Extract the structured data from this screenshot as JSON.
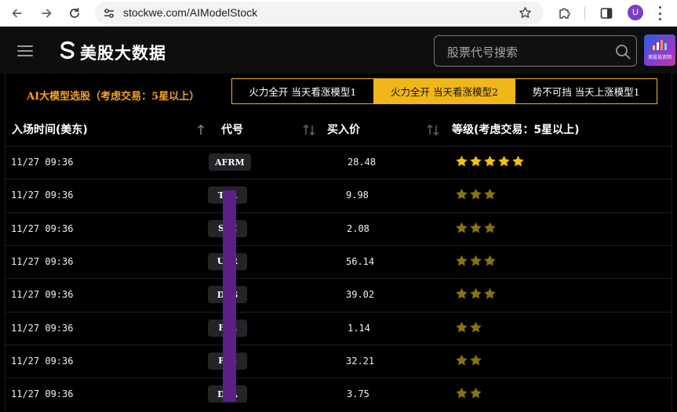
{
  "browser": {
    "url": "stockwe.com/AIModelStock",
    "avatar_letter": "U"
  },
  "header": {
    "logo_text": "美股大数据",
    "search_placeholder": "股票代号搜索",
    "promo_text": "美股投资网"
  },
  "page": {
    "ai_title": "AI大模型选股（考虑交易：5星以上）",
    "tabs": [
      {
        "label": "火力全开 当天看涨模型1",
        "active": false
      },
      {
        "label": "火力全开 当天看涨模型2",
        "active": true
      },
      {
        "label": "势不可挡 当天上涨模型1",
        "active": false
      }
    ],
    "columns": {
      "time": "入场时间(美东)",
      "symbol": "代号",
      "price": "买入价",
      "grade": "等级(考虑交易：5星以上)"
    },
    "rows": [
      {
        "time": "11/27 09:36",
        "symbol": "AFRM",
        "price": "28.48",
        "stars": 5
      },
      {
        "time": "11/27 09:36",
        "symbol": "T  A",
        "price": "9.98",
        "stars": 3
      },
      {
        "time": "11/27 09:36",
        "symbol": "S  E",
        "price": "2.08",
        "stars": 3
      },
      {
        "time": "11/27 09:36",
        "symbol": "U  R",
        "price": "56.14",
        "stars": 3
      },
      {
        "time": "11/27 09:36",
        "symbol": "D  G",
        "price": "39.02",
        "stars": 3
      },
      {
        "time": "11/27 09:36",
        "symbol": "F  L",
        "price": "1.14",
        "stars": 2
      },
      {
        "time": "11/27 09:36",
        "symbol": "P  S",
        "price": "32.21",
        "stars": 2
      },
      {
        "time": "11/27 09:36",
        "symbol": "D  A",
        "price": "3.75",
        "stars": 2
      }
    ]
  },
  "colors": {
    "accent": "#f1b619",
    "title_orange": "#f7a21f",
    "star_bright": "#f4c20d",
    "star_dim": "#8a7211"
  }
}
